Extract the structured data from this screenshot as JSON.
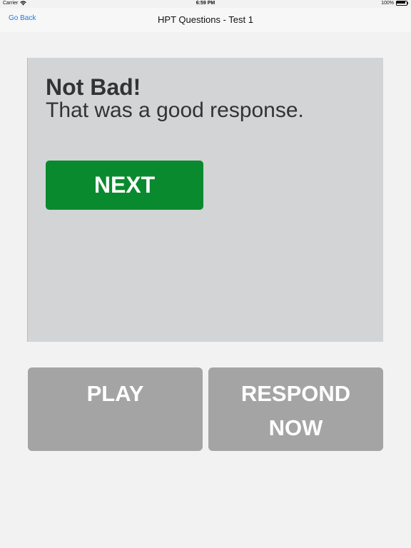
{
  "status_bar": {
    "carrier": "Carrier",
    "time": "6:59 PM",
    "battery": "100%",
    "battery_level": 1.0,
    "wifi_icon": "wifi-icon",
    "battery_icon": "battery-icon"
  },
  "nav": {
    "back_label": "Go Back",
    "title": "HPT Questions - Test 1"
  },
  "feedback": {
    "heading": "Not Bad!",
    "message": "That was a good response.",
    "next_label": "NEXT"
  },
  "actions": {
    "play_label": "PLAY",
    "respond_line1": "RESPOND",
    "respond_line2": "NOW"
  },
  "colors": {
    "background": "#f2f2f2",
    "panel": "#d3d4d6",
    "next_button": "#0a8a2e",
    "action_button": "#a4a4a4",
    "link": "#1a7ae6"
  }
}
